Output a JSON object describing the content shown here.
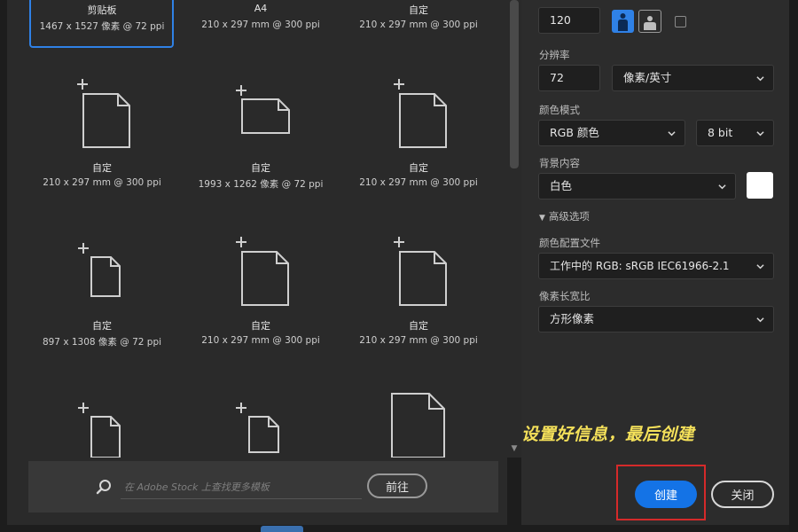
{
  "presets": [
    {
      "name": "剪贴板",
      "size": "1467 x 1527 像素 @ 72 ppi",
      "selected": true,
      "icon": "document-icon"
    },
    {
      "name": "A4",
      "size": "210 x 297 mm @ 300 ppi",
      "selected": false,
      "icon": "document-icon"
    },
    {
      "name": "自定",
      "size": "210 x 297 mm @ 300 ppi",
      "selected": false,
      "icon": "document-icon"
    },
    {
      "name": "自定",
      "size": "210 x 297 mm @ 300 ppi",
      "selected": false,
      "icon": "document-portrait-icon"
    },
    {
      "name": "自定",
      "size": "1993 x 1262 像素 @ 72 ppi",
      "selected": false,
      "icon": "document-landscape-icon"
    },
    {
      "name": "自定",
      "size": "210 x 297 mm @ 300 ppi",
      "selected": false,
      "icon": "document-portrait-icon"
    },
    {
      "name": "自定",
      "size": "897 x 1308 像素 @ 72 ppi",
      "selected": false,
      "icon": "document-small-icon"
    },
    {
      "name": "自定",
      "size": "210 x 297 mm @ 300 ppi",
      "selected": false,
      "icon": "document-portrait-icon"
    },
    {
      "name": "自定",
      "size": "210 x 297 mm @ 300 ppi",
      "selected": false,
      "icon": "document-portrait-icon"
    }
  ],
  "search": {
    "placeholder": "在 Adobe Stock 上查找更多模板",
    "go_label": "前往"
  },
  "settings": {
    "height_value": "120",
    "resolution_label": "分辨率",
    "resolution_value": "72",
    "resolution_unit": "像素/英寸",
    "color_mode_label": "颜色模式",
    "color_mode_value": "RGB 颜色",
    "bit_depth_value": "8 bit",
    "background_label": "背景内容",
    "background_value": "白色",
    "background_color": "#ffffff",
    "advanced_label": "高级选项",
    "color_profile_label": "颜色配置文件",
    "color_profile_value": "工作中的 RGB: sRGB IEC61966-2.1",
    "pixel_aspect_label": "像素长宽比",
    "pixel_aspect_value": "方形像素",
    "orientation": "portrait"
  },
  "caption": "设置好信息，最后创建",
  "actions": {
    "create_label": "创建",
    "close_label": "关闭"
  },
  "colors": {
    "accent": "#1473e6",
    "highlight": "#d52a2a",
    "caption": "#f5e15a"
  }
}
